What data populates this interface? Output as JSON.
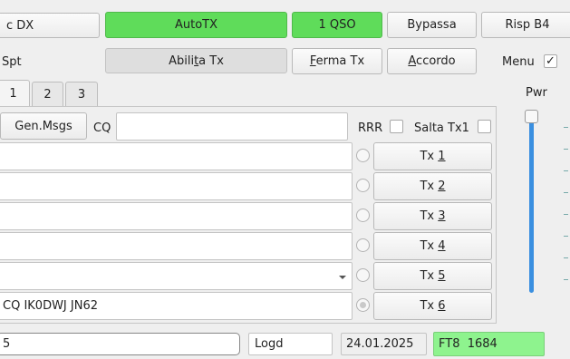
{
  "row1": {
    "dx_call": "c DX",
    "dx_call_underline": "X",
    "autotx": "AutoTX",
    "one_qso": "1 QSO",
    "bypassa": "Bypassa",
    "risp_b4": "Risp B4"
  },
  "row2": {
    "spt_label": "Spt",
    "abilita_pre": "Abili",
    "abilita_u": "t",
    "abilita_post": "a Tx",
    "ferma_u": "F",
    "ferma_post": "erma Tx",
    "accordo_u": "A",
    "accordo_post": "ccordo",
    "menu_label": "Menu",
    "menu_check": "✓"
  },
  "tabs": [
    "1",
    "2",
    "3"
  ],
  "pwr_label": "Pwr",
  "msgs": {
    "gen_msgs": "Gen.Msgs",
    "cq_label": "CQ",
    "cq_value": "",
    "rrr_label": "RRR",
    "salta_label": "Salta Tx1"
  },
  "tx_rows": [
    {
      "text": "",
      "button": "Tx",
      "num": "1"
    },
    {
      "text": "",
      "button": "Tx",
      "num": "2"
    },
    {
      "text": "",
      "button": "Tx",
      "num": "3"
    },
    {
      "text": "",
      "button": "Tx",
      "num": "4"
    },
    {
      "text": "",
      "button": "Tx",
      "num": "5"
    },
    {
      "text": "CQ IK0DWJ JN62",
      "button": "Tx",
      "num": "6"
    }
  ],
  "status": {
    "left": "5",
    "logd": "Logd",
    "date": "24.01.2025",
    "mode": "FT8  1684"
  },
  "colors": {
    "green": "#5fdc5a",
    "status_green": "#8ef38e",
    "slider_blue": "#3a8fe0"
  }
}
